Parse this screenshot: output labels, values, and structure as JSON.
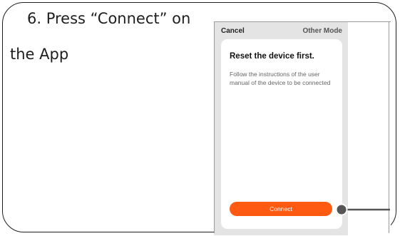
{
  "instruction": {
    "line1": "6. Press “Connect” on",
    "line2": "the App"
  },
  "app": {
    "header": {
      "cancel_label": "Cancel",
      "other_mode_label": "Other Mode"
    },
    "card": {
      "title": "Reset the device first.",
      "description": "Follow the instructions of the user manual of the device to be connected",
      "connect_label": "Connect"
    }
  },
  "colors": {
    "connect_button": "#ff5a12",
    "phone_background": "#e4e4e4",
    "pointer_line": "#555555"
  },
  "icons": {
    "pointer": "callout-dot-icon"
  }
}
